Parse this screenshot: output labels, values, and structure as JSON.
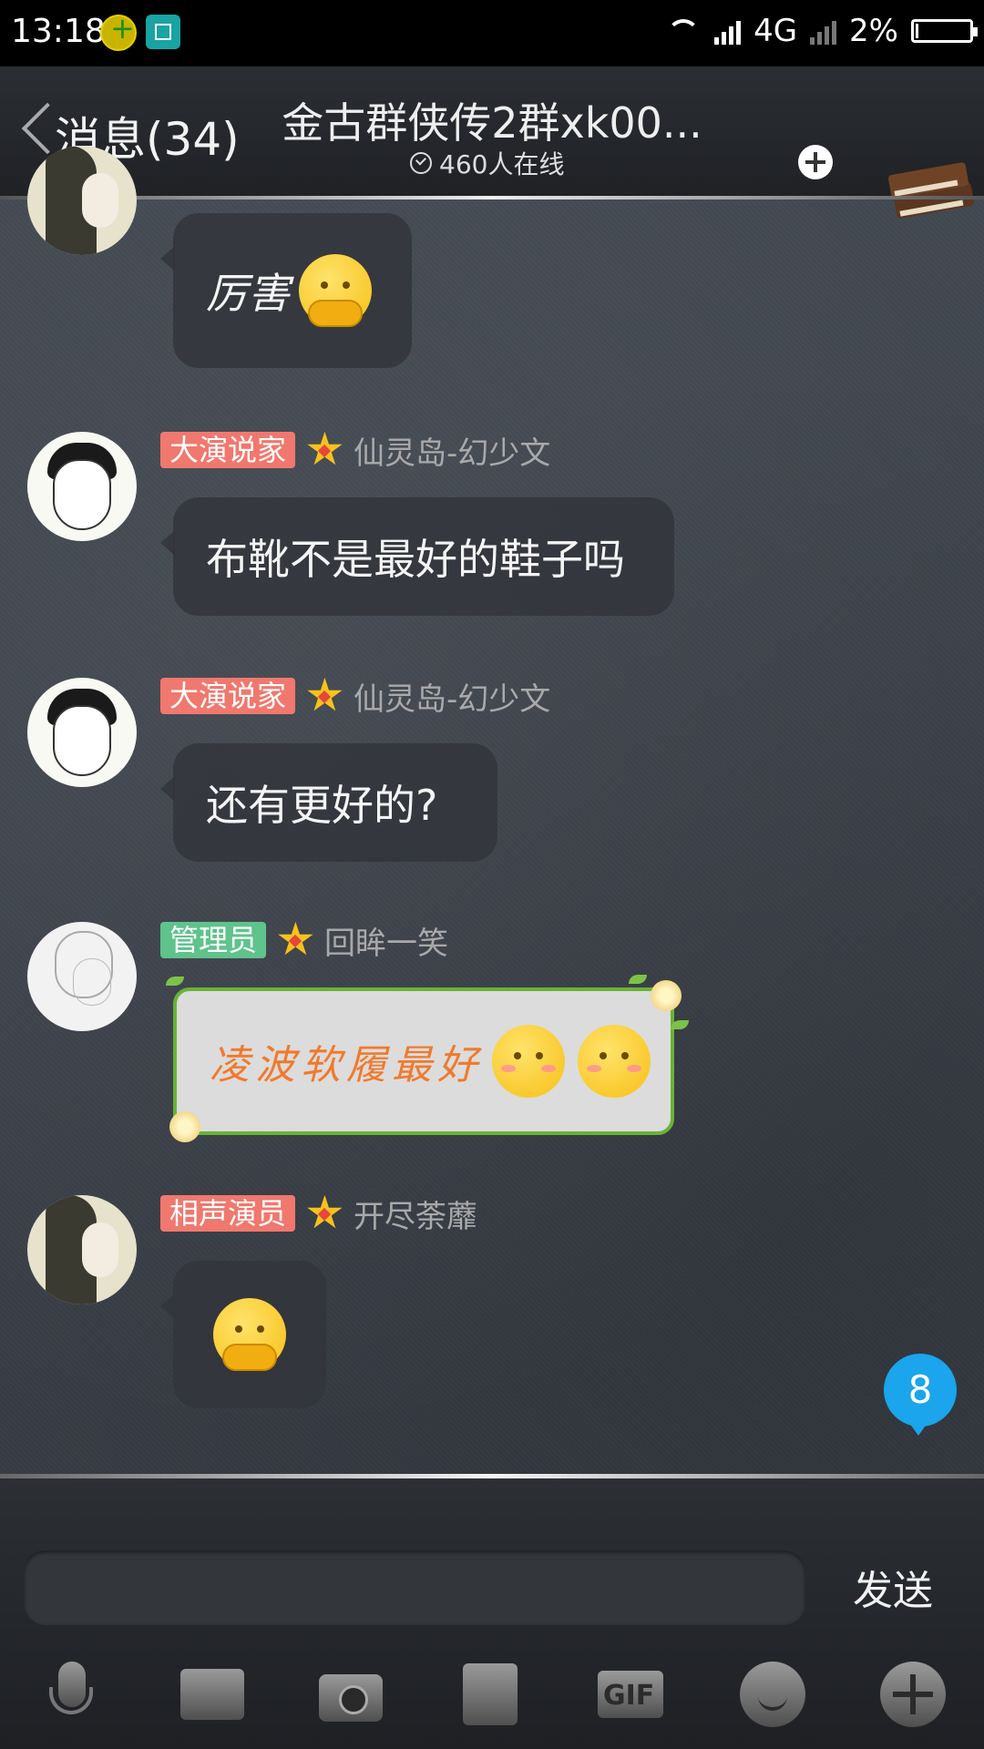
{
  "status_bar": {
    "time": "13:18",
    "network": "4G",
    "battery": "2%"
  },
  "header": {
    "back_label": "消息(34)",
    "title": "金古群侠传2群xk00...",
    "online": "460人在线"
  },
  "messages": [
    {
      "text": "厉害"
    },
    {
      "tag": "大演说家",
      "sender": "仙灵岛-幻少文",
      "text": "布靴不是最好的鞋子吗"
    },
    {
      "tag": "大演说家",
      "sender": "仙灵岛-幻少文",
      "text": "还有更好的?"
    },
    {
      "tag": "管理员",
      "sender": "回眸一笑",
      "text": "凌波软履最好"
    },
    {
      "tag": "相声演员",
      "sender": "开尽荼蘼",
      "text": ""
    }
  ],
  "unread_count": "8",
  "input": {
    "placeholder": "",
    "send_label": "发送"
  },
  "toolbar_icons": [
    "mic-icon",
    "image-icon",
    "camera-icon",
    "card-icon",
    "gif-icon",
    "emoji-icon",
    "plus-icon"
  ],
  "colors": {
    "tag_red": "#f0786e",
    "tag_green": "#5fc38c",
    "badge_blue": "#1aa5ec",
    "vip_border": "#68b336",
    "vip_text": "#f07a2c"
  }
}
